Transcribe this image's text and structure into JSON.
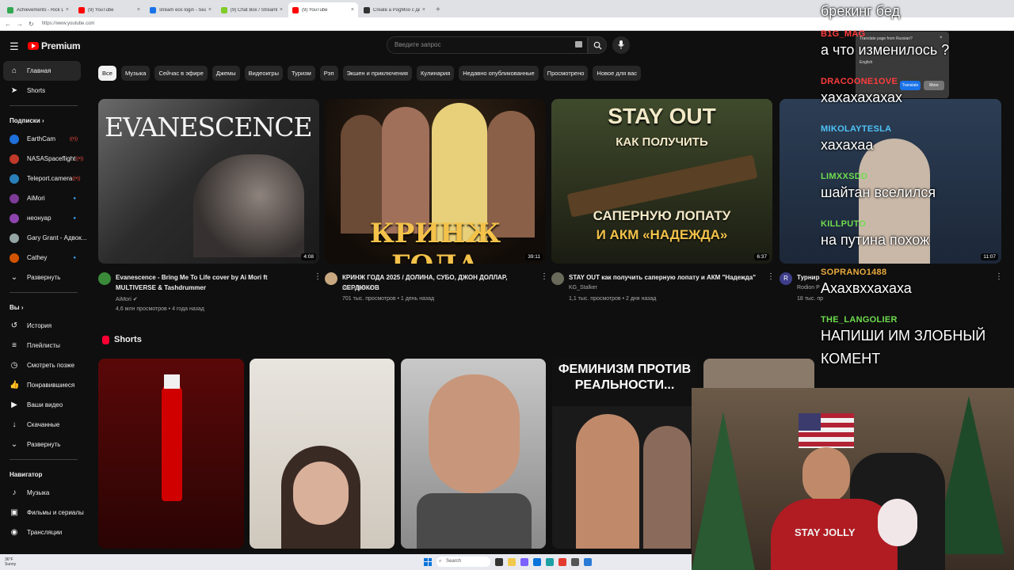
{
  "browser": {
    "tabs": [
      {
        "title": "Achievements - Rick Dashboard",
        "color": "#34a853",
        "active": false
      },
      {
        "title": "(9) YouTube",
        "color": "#ff0000",
        "active": false
      },
      {
        "title": "stream eos login - Search",
        "color": "#1a73e8",
        "active": false
      },
      {
        "title": "(9) Chat Box / StreamLabs",
        "color": "#80cc28",
        "active": false
      },
      {
        "title": "(9) YouTube",
        "color": "#ff0000",
        "active": true
      },
      {
        "title": "Create a PogMoo с деньгами То...",
        "color": "#333333",
        "active": false
      }
    ],
    "new_tab": "+",
    "url": "https://www.youtube.com"
  },
  "header": {
    "logo_text": "Premium",
    "search_placeholder": "Введите запрос"
  },
  "sidebar": {
    "main": [
      {
        "label": "Главная",
        "icon": "home-icon",
        "glyph": "⌂",
        "active": true
      },
      {
        "label": "Shorts",
        "icon": "shorts-icon",
        "glyph": "➤",
        "active": false
      }
    ],
    "subs_title": "Подписки",
    "subs": [
      {
        "label": "EarthCam",
        "color": "#1e6fd9",
        "badge": "live"
      },
      {
        "label": "NASASpaceflight",
        "color": "#c0392b",
        "badge": "live"
      },
      {
        "label": "Teleport.camera",
        "color": "#2980b9",
        "badge": "live"
      },
      {
        "label": "AiMori",
        "color": "#7d3c98",
        "badge": "dot"
      },
      {
        "label": "неонуар",
        "color": "#8e44ad",
        "badge": "dot"
      },
      {
        "label": "Gary Grant - Адвок...",
        "color": "#95a5a6",
        "badge": "none"
      },
      {
        "label": "Cathey",
        "color": "#d35400",
        "badge": "dot"
      }
    ],
    "expand": "Развернуть",
    "you_title": "Вы",
    "you": [
      {
        "label": "История",
        "glyph": "↺"
      },
      {
        "label": "Плейлисты",
        "glyph": "≡"
      },
      {
        "label": "Смотреть позже",
        "glyph": "◷"
      },
      {
        "label": "Понравившиеся",
        "glyph": "👍"
      },
      {
        "label": "Ваши видео",
        "glyph": "▶"
      },
      {
        "label": "Скачанные",
        "glyph": "↓"
      },
      {
        "label": "Развернуть",
        "glyph": "⌄"
      }
    ],
    "nav_title": "Навигатор",
    "nav": [
      {
        "label": "Музыка",
        "glyph": "♪"
      },
      {
        "label": "Фильмы и сериалы",
        "glyph": "▣"
      },
      {
        "label": "Трансляции",
        "glyph": "◉"
      }
    ]
  },
  "chips": [
    "Все",
    "Музыка",
    "Сейчас в эфире",
    "Джемы",
    "Видеоигры",
    "Туризм",
    "Рэп",
    "Экшен и приключения",
    "Кулинария",
    "Недавно опубликованные",
    "Просмотрено",
    "Новое для вас"
  ],
  "videos": [
    {
      "title": "Evanescence - Bring Me To Life cover by Ai Mori ft MULTIVERSE & Tashdrummer",
      "channel": "AiMori",
      "meta": "4,6 млн просмотров • 4 года назад",
      "duration": "4:08",
      "thumb_text": "EVANESCENCE"
    },
    {
      "title": "КРИНЖ ГОДА 2025 / ДОЛИНА, СУБО, ДЖОН ДОЛЛАР, СЕРДЮКОВ",
      "channel": "РЫНДЫЧ",
      "meta": "701 тыс. просмотров • 1 день назад",
      "duration": "39:11",
      "thumb_text": "КРИНЖ ГОДА"
    },
    {
      "title": "STAY OUT как получить саперную лопату и АКМ \"Надежда\"",
      "channel": "KG_Stalker",
      "meta": "1,1 тыс. просмотров • 2 дня назад",
      "duration": "6:37",
      "thumb_text_1": "STAY OUT",
      "thumb_text_2": "КАК ПОЛУЧИТЬ",
      "thumb_text_3": "САПЕРНУЮ ЛОПАТУ",
      "thumb_text_4": "И АКМ «НАДЕЖДА»"
    },
    {
      "title": "Турнир",
      "channel": "Rodion P",
      "meta": "18 тыс. пр",
      "duration": "11:07"
    }
  ],
  "shorts": {
    "title": "Shorts",
    "items": [
      {
        "text": ""
      },
      {
        "text": ""
      },
      {
        "text": ""
      },
      {
        "text": "ФЕМИНИЗМ ПРОТИВ РЕАЛЬНОСТИ..."
      }
    ]
  },
  "chat": [
    {
      "name": "",
      "name_color": "#ffffff",
      "msg": "брекинг бед"
    },
    {
      "name": "B1G_MAG",
      "name_color": "#ff3b3b",
      "msg": "а что изменилось ?"
    },
    {
      "name": "DRACOONE1OVE",
      "name_color": "#ff3b3b",
      "msg": "хахахахахах"
    },
    {
      "name": "MIKOLAYTESLA",
      "name_color": "#4fc3f7",
      "msg": "хахахаа"
    },
    {
      "name": "LIMXXSDD",
      "name_color": "#6fdc4f",
      "msg": "шайтан вселился"
    },
    {
      "name": "KILLPUTO",
      "name_color": "#6fdc4f",
      "msg": "на путина похож"
    },
    {
      "name": "SOPRANO1488",
      "name_color": "#e8a93c",
      "msg": "Ахахвххахаха"
    },
    {
      "name": "THE_LANGOLIER",
      "name_color": "#6fdc4f",
      "msg": "НАПИШИ ИМ ЗЛОБНЫЙ КОМЕНТ"
    }
  ],
  "translate_popup": {
    "title": "Translate page from Russian?",
    "option": "English",
    "translate_btn": "Translate",
    "more_btn": "More"
  },
  "webcam": {
    "shirt_text": "STAY JOLLY"
  },
  "taskbar": {
    "weather_temp": "36°F",
    "weather_desc": "Sunny",
    "search_label": "Search"
  }
}
